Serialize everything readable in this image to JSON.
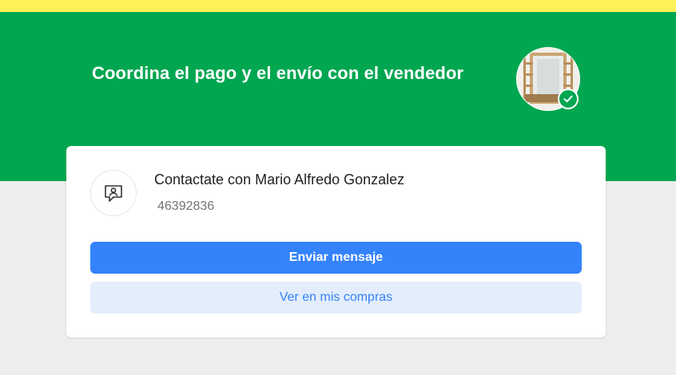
{
  "header": {
    "title": "Coordina el pago y el envío con el vendedor",
    "product_thumbnail": "product-thumbnail-shelf",
    "status_icon": "check-icon"
  },
  "contact": {
    "icon": "contact-message-icon",
    "title": "Contactate con Mario Alfredo Gonzalez",
    "phone": "46392836"
  },
  "actions": {
    "primary_label": "Enviar mensaje",
    "secondary_label": "Ver en mis compras"
  },
  "colors": {
    "top_bar": "#fff159",
    "hero": "#00a650",
    "primary_button": "#3483fa",
    "secondary_button_bg": "#e3edfb",
    "page_background": "#ededed"
  }
}
